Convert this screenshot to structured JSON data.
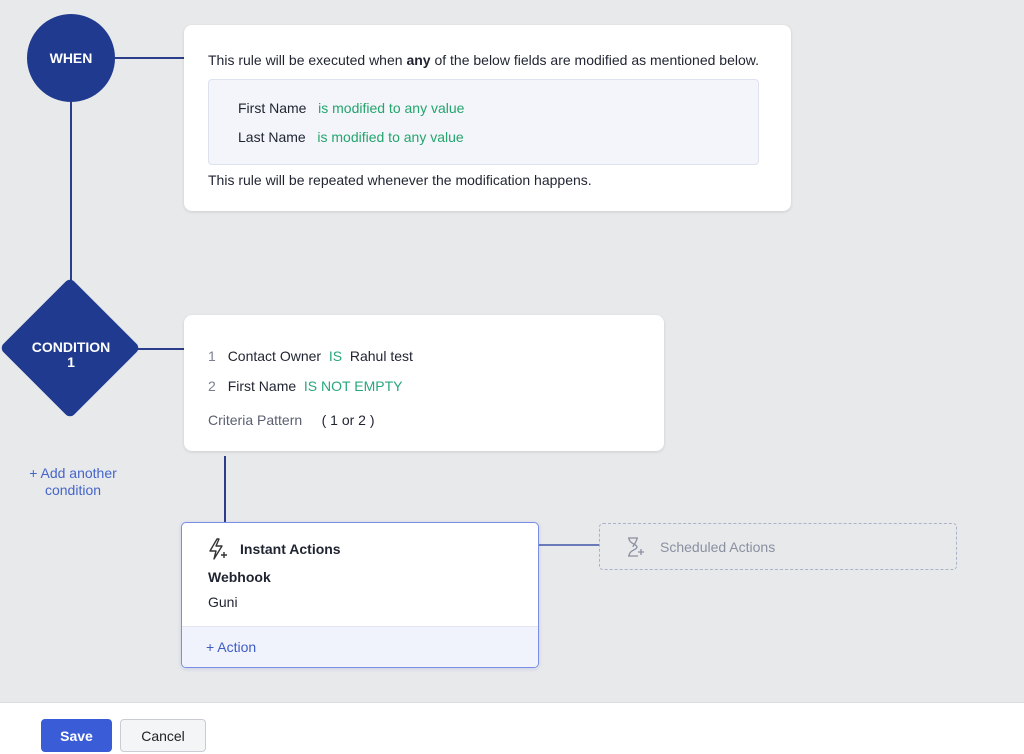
{
  "when": {
    "label": "WHEN",
    "intro_pre": "This rule will be executed when ",
    "intro_bold": "any",
    "intro_post": " of the below fields are modified as mentioned below.",
    "fields": [
      {
        "name": "First Name",
        "condition": "is modified to",
        "value": "any value"
      },
      {
        "name": "Last Name",
        "condition": "is modified to",
        "value": "any value"
      }
    ],
    "repeat_text": "This rule will be repeated whenever the modification happens."
  },
  "condition": {
    "label_line1": "CONDITION",
    "label_line2": "1",
    "criteria": [
      {
        "num": "1",
        "field": "Contact Owner",
        "operator": "IS",
        "value": "Rahul test"
      },
      {
        "num": "2",
        "field": "First Name",
        "operator": "IS NOT EMPTY",
        "value": ""
      }
    ],
    "pattern_label": "Criteria Pattern",
    "pattern_value": "( 1 or 2 )"
  },
  "add_condition": {
    "line1": "+ Add another",
    "line2": "condition"
  },
  "instant_actions": {
    "title": "Instant Actions",
    "action_type": "Webhook",
    "action_name": "Guni",
    "add_action": "+ Action"
  },
  "scheduled_actions": {
    "title": "Scheduled Actions"
  },
  "footer": {
    "save": "Save",
    "cancel": "Cancel"
  },
  "colors": {
    "node_blue": "#1f3a8f",
    "accent": "#3a5cd6",
    "green": "#25a46b"
  }
}
